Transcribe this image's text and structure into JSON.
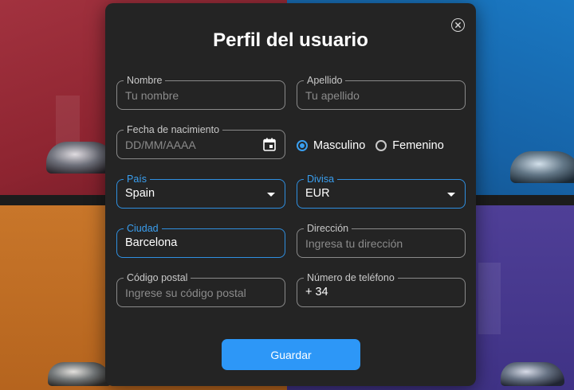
{
  "dialog": {
    "title": "Perfil del usuario",
    "close_icon": "close-circle-icon",
    "accent_color": "#3a9ff0",
    "button_color": "#2d97f7"
  },
  "fields": {
    "nombre": {
      "label": "Nombre",
      "placeholder": "Tu nombre"
    },
    "apellido": {
      "label": "Apellido",
      "placeholder": "Tu apellido"
    },
    "fecha": {
      "label": "Fecha de nacimiento",
      "placeholder": "DD/MM/AAAA",
      "icon": "calendar-icon"
    },
    "pais": {
      "label": "País",
      "value": "Spain"
    },
    "divisa": {
      "label": "Divisa",
      "value": "EUR"
    },
    "ciudad": {
      "label": "Ciudad",
      "value": "Barcelona"
    },
    "direccion": {
      "label": "Dirección",
      "placeholder": "Ingresa tu dirección"
    },
    "codigo_postal": {
      "label": "Código postal",
      "placeholder": "Ingrese su código postal"
    },
    "telefono": {
      "label": "Número de teléfono",
      "value": "+ 34"
    }
  },
  "gender": {
    "options": [
      "Masculino",
      "Femenino"
    ],
    "selected": "Masculino"
  },
  "actions": {
    "save_label": "Guardar"
  }
}
